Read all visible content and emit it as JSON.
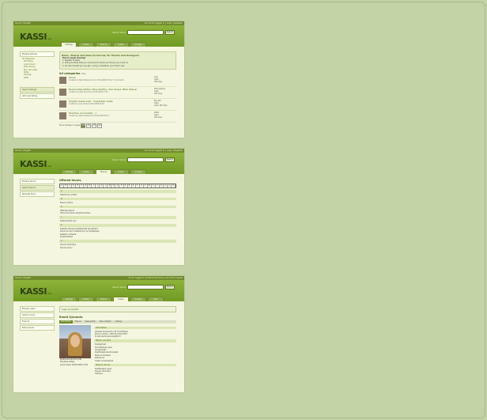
{
  "shot1": {
    "topbar_left": "Suomi | English",
    "topbar_right": "You're not logged in | Login | Register",
    "logo": "KASSI",
    "logo_sub": "beta",
    "search_label": "Search items",
    "search_button": "Search",
    "tabs": [
      "Listings",
      "Items",
      "Favors",
      "Users",
      "Groups"
    ],
    "active_tab": 0,
    "sidebar_items": [
      "Browse listings",
      "All categories"
    ],
    "sidebar_subs": [
      "Borrowing",
      "Lost & found",
      "Ride sharing",
      "Buy, sell, swap",
      "Rides",
      "Housing",
      "Other"
    ],
    "sidebar_bottom": [
      "Search listings",
      "Add new listing"
    ],
    "intro_title": "Kassi - Shares and items to borrow, for friends and strangers!",
    "intro_heading": "How to begin Kassing?",
    "intro_lines": [
      "1. Register to Kassi",
      "2. Add your items that you could lend to others and favors you could do",
      "3. Go look at what you can get + bring in whatever you'd like to ask"
    ],
    "section_title": "All categories",
    "section_rss": "(RSS)",
    "listings": [
      {
        "title": "Olivia",
        "sub": "Created by Mars Takanen from 17.06.2008 07:26 | 5 comments",
        "cat": "Lost",
        "status": "Open",
        "end": "365 days"
      },
      {
        "title": "Bussimatka lähtee, Elisa Kuittila, USA Kenya, Nibe Wiener",
        "sub": "Created by Lotta Huovinen 18.06.2008 17:23",
        "cat": "Ride sharing",
        "status": "Open",
        "end": "265 days"
      },
      {
        "title": "Kirjasto pelaa koko - kirjatukee ostaa",
        "sub": "Created by Lisa Hovila 18.06.2008 06:45",
        "cat": "Buy sell",
        "status": "Open",
        "end": "Open 365 days"
      },
      {
        "title": "Muuttoa, kuormatila - ?",
        "sub": "Created by Kalle Veikkainen 18.06.2008 08:15",
        "cat": "Other",
        "status": "Open",
        "end": "365 days"
      }
    ],
    "pager_label": "Show listings on page",
    "pages": [
      "10",
      "20",
      "30",
      "40"
    ],
    "current_page": 0
  },
  "shot2": {
    "topbar_left": "Suomi | English",
    "topbar_right": "You're not logged in | Login | Register",
    "logo": "KASSI",
    "logo_sub": "beta",
    "search_label": "Search items",
    "search_button": "Search",
    "tabs": [
      "Listings",
      "Items",
      "Favors",
      "Users",
      "Groups"
    ],
    "active_tab": 2,
    "sidebar_items": [
      "Browse favors",
      "Search favors",
      "Request favor"
    ],
    "title": "Offered favors",
    "letters": [
      "A",
      "B",
      "C",
      "D",
      "E",
      "F",
      "G",
      "H",
      "I",
      "J",
      "K",
      "L",
      "M",
      "N",
      "O",
      "P",
      "Q",
      "R",
      "S",
      "T",
      "U",
      "V",
      "W",
      "X",
      "Y",
      "Z",
      "Å",
      "Ä",
      "Ö"
    ],
    "groups": [
      {
        "letter": "A",
        "rows": [
          "Hakeminen auttaa"
        ]
      },
      {
        "letter": "B",
        "rows": [
          "Bussin odotus"
        ]
      },
      {
        "letter": "H",
        "rows": [
          "Häämaa kaarat",
          "Henna tai toinen syöpävä kanssa"
        ]
      },
      {
        "letter": "I",
        "rows": [
          "Itsepuolustus apu"
        ]
      },
      {
        "letter": "K",
        "rows": [
          "Kaiteita autossa kuljettamiset tai leikkarit",
          "Kalvinnan apu maalaamoon ja näytteeseen",
          "Kesäkoti, palvelut",
          "Kirjastoaikaan"
        ]
      },
      {
        "letter": "S",
        "rows": [
          "Saunan lämmitys",
          "Sienien keruu"
        ]
      }
    ]
  },
  "shot3": {
    "topbar_left": "Suomi | English",
    "topbar_right": "You're logged in as Eemil Sylvania | Account | Logout",
    "logo": "KASSI",
    "logo_sub": "beta",
    "search_label": "Search items",
    "search_button": "Search",
    "tabs": [
      "Listings",
      "Items",
      "Favors",
      "Users",
      "Groups",
      "Own"
    ],
    "active_tab": 3,
    "sidebar_items": [
      "Browse users",
      "Search users",
      "Friends",
      "Kassi-points"
    ],
    "notice": "Login successful",
    "name": "Eemil Sylvania",
    "profile_tabs": [
      "Information",
      "Friends",
      "Kassi-points",
      "Own contacts",
      "Listings"
    ],
    "photo_caption": [
      "Kerää kaveriksi tai pidä",
      "Muokkaa tietoja",
      "Joined Kassi 18.06.2008 13:08"
    ],
    "info_title": "Information",
    "info_lines": [
      "Address Sylvanintie 2 B 14 00 Espoo",
      "Phone number +358 40 1234 5678",
      "E-mail eemil.sylvania@tkk.fi"
    ],
    "items_title": "Items I can lend",
    "items": [
      "Dialogikirjat",
      "Ammattiopas opas",
      "Lemppukello",
      "Paahtoleipä pientä leipää",
      "Nokia kuulokkeet",
      "Kalliokivet",
      "Tilattu urheilukamat"
    ],
    "favors_title": "Favors I can do",
    "favors": [
      "Skeittikaapin apua",
      "Saunan lämmitys",
      "Leikkaus"
    ]
  }
}
